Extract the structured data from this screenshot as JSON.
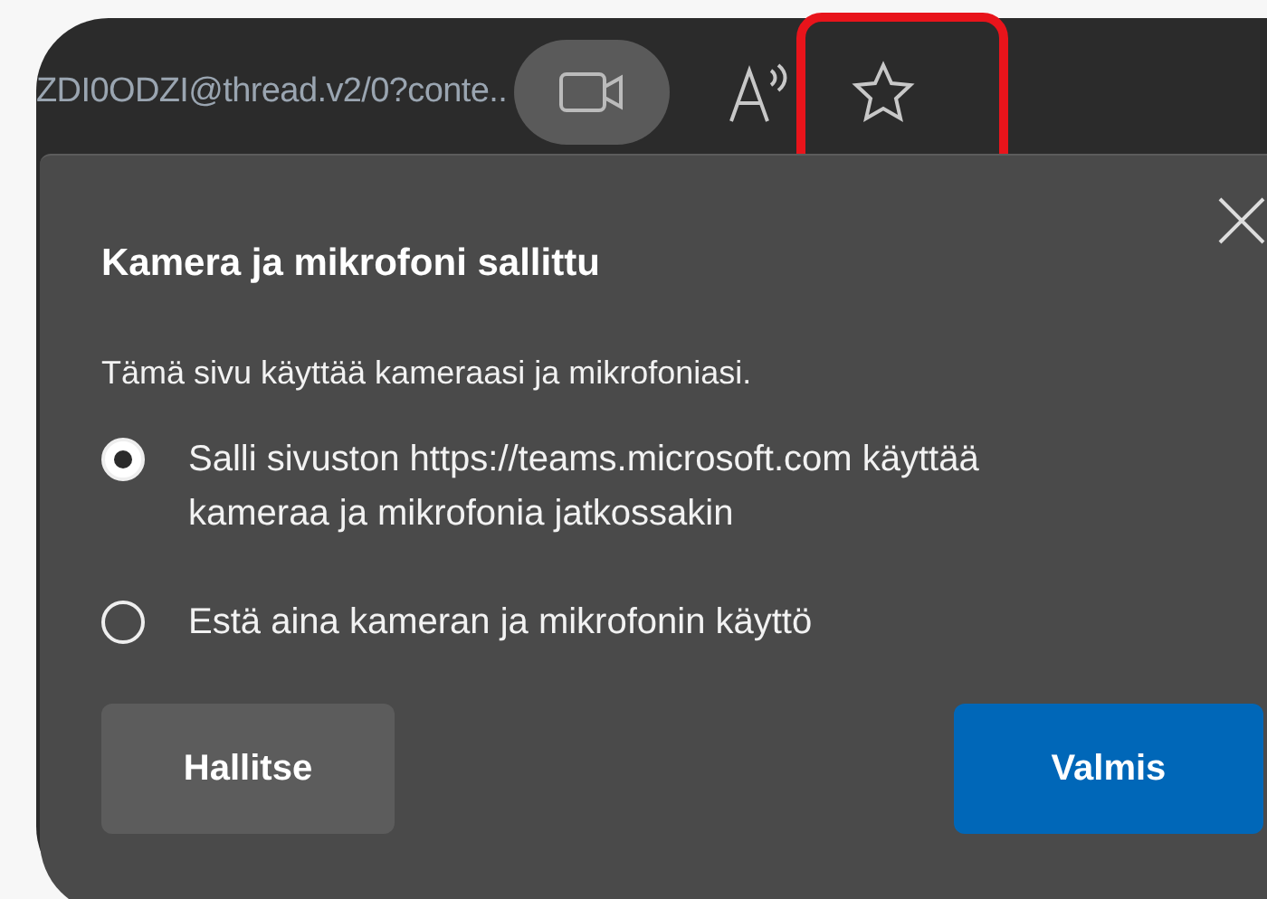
{
  "address_bar": {
    "url": "ZDI0ODZI@thread.v2/0?conte.."
  },
  "permission_popup": {
    "title": "Kamera ja mikrofoni sallittu",
    "description": "Tämä sivu käyttää kameraasi ja mikrofoniasi.",
    "options": [
      {
        "label": "Salli sivuston https://teams.microsoft.com käyttää kameraa ja mikrofonia jatkossakin",
        "selected": true
      },
      {
        "label": "Estä aina kameran ja mikrofonin käyttö",
        "selected": false
      }
    ],
    "buttons": [
      {
        "label": "Hallitse",
        "kind": "secondary"
      },
      {
        "label": "Valmis",
        "kind": "primary"
      }
    ]
  }
}
